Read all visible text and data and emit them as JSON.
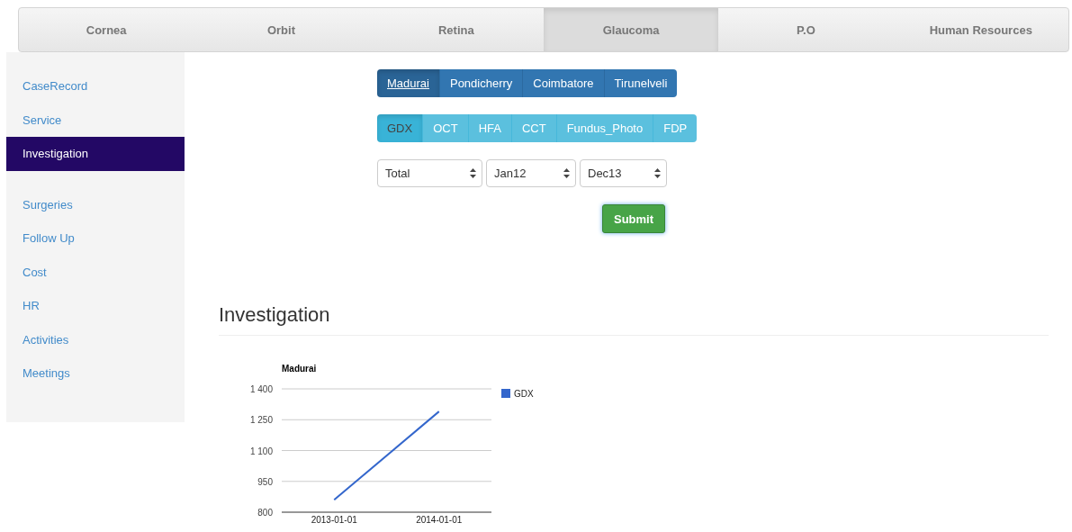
{
  "nav_tabs": [
    {
      "label": "Cornea",
      "selected": false
    },
    {
      "label": "Orbit",
      "selected": false
    },
    {
      "label": "Retina",
      "selected": false
    },
    {
      "label": "Glaucoma",
      "selected": true
    },
    {
      "label": "P.O",
      "selected": false
    },
    {
      "label": "Human Resources",
      "selected": false
    }
  ],
  "sidebar": {
    "groups": [
      [
        {
          "label": "CaseRecord",
          "selected": false
        },
        {
          "label": "Service",
          "selected": false
        },
        {
          "label": "Investigation",
          "selected": true
        }
      ],
      [
        {
          "label": "Surgeries",
          "selected": false
        },
        {
          "label": "Follow Up",
          "selected": false
        },
        {
          "label": "Cost",
          "selected": false
        },
        {
          "label": "HR",
          "selected": false
        },
        {
          "label": "Activities",
          "selected": false
        },
        {
          "label": "Meetings",
          "selected": false
        }
      ]
    ]
  },
  "centers": [
    {
      "label": "Madurai",
      "selected": true
    },
    {
      "label": "Pondicherry",
      "selected": false
    },
    {
      "label": "Coimbatore",
      "selected": false
    },
    {
      "label": "Tirunelveli",
      "selected": false
    }
  ],
  "modules": [
    {
      "label": "GDX",
      "selected": true
    },
    {
      "label": "OCT",
      "selected": false
    },
    {
      "label": "HFA",
      "selected": false
    },
    {
      "label": "CCT",
      "selected": false
    },
    {
      "label": "Fundus_Photo",
      "selected": false
    },
    {
      "label": "FDP",
      "selected": false
    }
  ],
  "filters": [
    {
      "value": "Total"
    },
    {
      "value": "Jan12"
    },
    {
      "value": "Dec13"
    }
  ],
  "submit": "Submit",
  "section": {
    "title": "Investigation",
    "chart_data": {
      "type": "line",
      "title": "Madurai",
      "categories": [
        "2013-01-01",
        "2014-01-01"
      ],
      "series": [
        {
          "name": "GDX",
          "color": "#3366cc",
          "values": [
            860,
            1290
          ]
        }
      ],
      "ylim": [
        800,
        1400
      ],
      "grid": true,
      "yticks": [
        {
          "value": 800,
          "label": "800"
        },
        {
          "value": 950,
          "label": "950"
        },
        {
          "value": 1100,
          "label": "1 100"
        },
        {
          "value": 1250,
          "label": "1 250"
        },
        {
          "value": 1400,
          "label": "1 400"
        }
      ]
    }
  }
}
